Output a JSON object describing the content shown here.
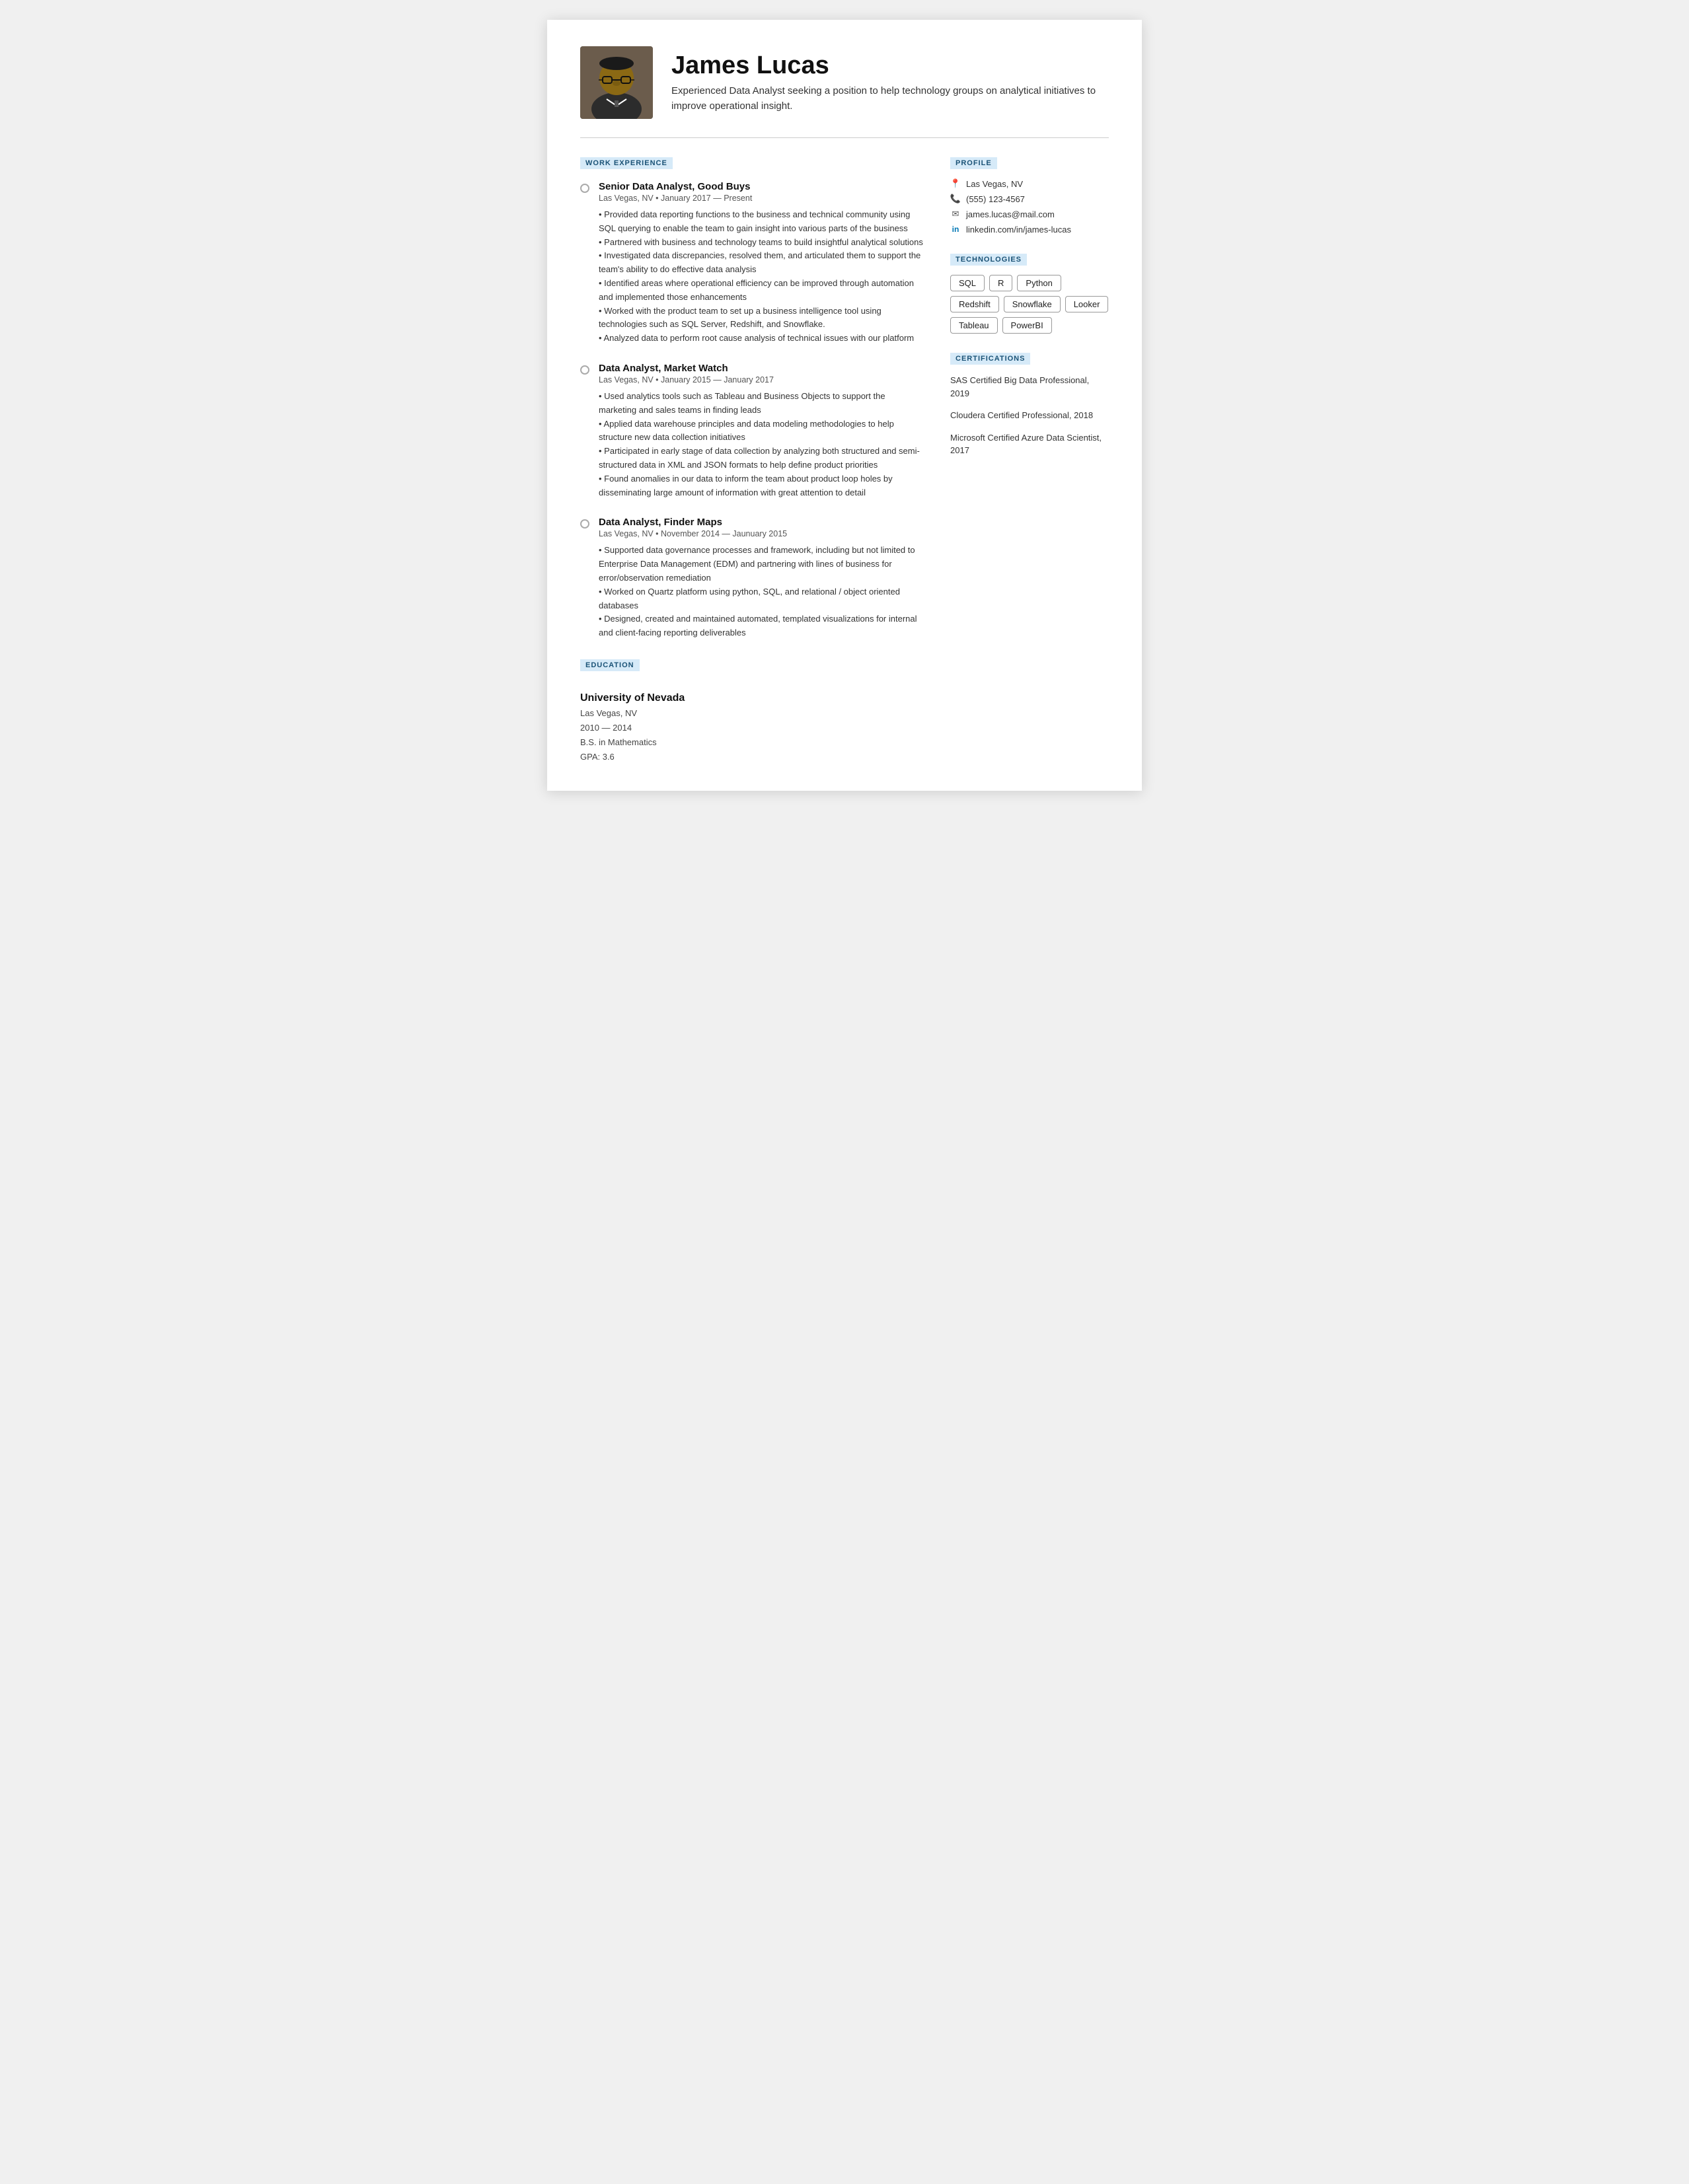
{
  "header": {
    "name": "James Lucas",
    "summary": "Experienced Data Analyst seeking a position to help technology groups on analytical initiatives to improve operational insight."
  },
  "sections": {
    "work_experience_label": "WORK EXPERIENCE",
    "education_label": "EDUCATION",
    "profile_label": "PROFILE",
    "technologies_label": "TECHNOLOGIES",
    "certifications_label": "CERTIFICATIONS"
  },
  "jobs": [
    {
      "title": "Senior Data Analyst, Good Buys",
      "meta": "Las Vegas, NV • January 2017 — Present",
      "desc": "• Provided data reporting functions to the business and technical community using SQL querying to enable the team to gain insight into various parts of the business\n• Partnered with business and technology teams to build insightful analytical solutions\n• Investigated data discrepancies, resolved them, and articulated them to support the team's ability to do effective data analysis\n• Identified areas where operational efficiency can be improved through automation and implemented those enhancements\n• Worked with the product team to set up a business intelligence tool using technologies such as SQL Server, Redshift, and Snowflake.\n• Analyzed data to perform root cause analysis of technical issues with our platform"
    },
    {
      "title": "Data Analyst, Market Watch",
      "meta": "Las Vegas, NV • January 2015 — January 2017",
      "desc": "• Used analytics tools such as Tableau and Business Objects to support the marketing and sales teams in finding leads\n• Applied data warehouse principles and data modeling methodologies to help structure new data collection initiatives\n• Participated in early stage of data collection by analyzing both structured and semi-structured data in XML and JSON formats to help define product priorities\n• Found anomalies in our data to inform the team about product loop holes by disseminating large amount of information with great attention to detail"
    },
    {
      "title": "Data Analyst, Finder Maps",
      "meta": "Las Vegas, NV • November 2014 — Jaunuary 2015",
      "desc": "• Supported data governance processes and framework, including but not limited to Enterprise Data Management (EDM) and partnering with lines of business for error/observation remediation\n• Worked on Quartz platform using python, SQL, and relational / object oriented databases\n• Designed, created and maintained automated, templated visualizations for internal and client-facing reporting deliverables"
    }
  ],
  "education": {
    "school": "University of Nevada",
    "location": "Las Vegas, NV",
    "years": "2010 — 2014",
    "degree": "B.S. in Mathematics",
    "gpa": "GPA: 3.6"
  },
  "profile": {
    "location": "Las Vegas, NV",
    "phone": "(555) 123-4567",
    "email": "james.lucas@mail.com",
    "linkedin": "linkedin.com/in/james-lucas"
  },
  "technologies": [
    "SQL",
    "R",
    "Python",
    "Redshift",
    "Snowflake",
    "Looker",
    "Tableau",
    "PowerBI"
  ],
  "certifications": [
    "SAS Certified Big Data Professional, 2019",
    "Cloudera Certified Professional, 2018",
    "Microsoft Certified Azure Data Scientist, 2017"
  ]
}
